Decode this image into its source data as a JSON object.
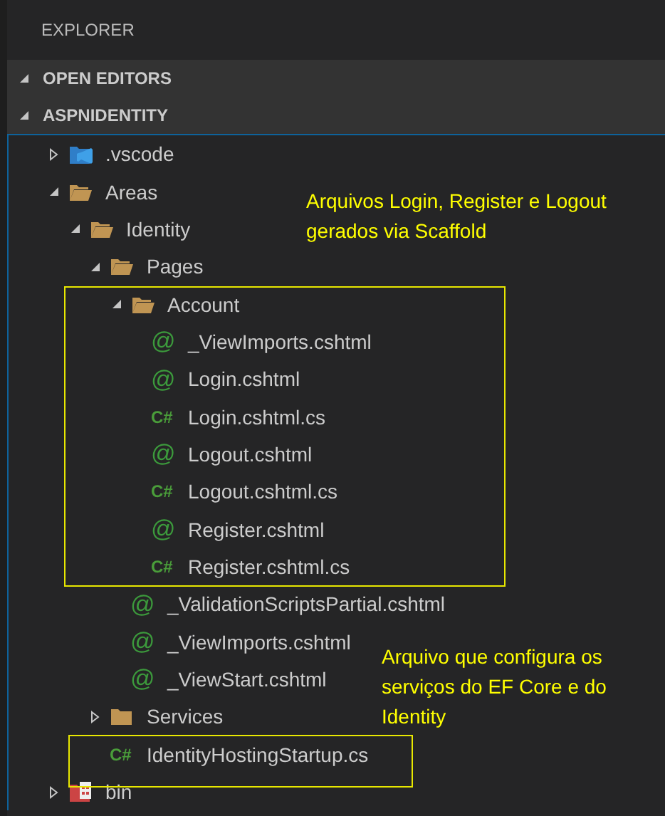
{
  "panel": {
    "title": "EXPLORER"
  },
  "sections": [
    {
      "label": "OPEN EDITORS",
      "expanded": true
    },
    {
      "label": "ASPNIDENTITY",
      "expanded": true
    }
  ],
  "tree": [
    {
      "label": ".vscode",
      "kind": "vscode-folder",
      "expanded": false
    },
    {
      "label": "Areas",
      "kind": "folder",
      "expanded": true,
      "children": [
        {
          "label": "Identity",
          "kind": "folder",
          "expanded": true,
          "children": [
            {
              "label": "Pages",
              "kind": "folder",
              "expanded": true,
              "children": [
                {
                  "label": "Account",
                  "kind": "folder",
                  "expanded": true,
                  "children": [
                    {
                      "label": "_ViewImports.cshtml",
                      "kind": "file",
                      "icon": "@"
                    },
                    {
                      "label": "Login.cshtml",
                      "kind": "file",
                      "icon": "@"
                    },
                    {
                      "label": "Login.cshtml.cs",
                      "kind": "file",
                      "icon": "C#"
                    },
                    {
                      "label": "Logout.cshtml",
                      "kind": "file",
                      "icon": "@"
                    },
                    {
                      "label": "Logout.cshtml.cs",
                      "kind": "file",
                      "icon": "C#"
                    },
                    {
                      "label": "Register.cshtml",
                      "kind": "file",
                      "icon": "@"
                    },
                    {
                      "label": "Register.cshtml.cs",
                      "kind": "file",
                      "icon": "C#"
                    }
                  ]
                },
                {
                  "label": "_ValidationScriptsPartial.cshtml",
                  "kind": "file",
                  "icon": "@"
                },
                {
                  "label": "_ViewImports.cshtml",
                  "kind": "file",
                  "icon": "@"
                },
                {
                  "label": "_ViewStart.cshtml",
                  "kind": "file",
                  "icon": "@"
                }
              ]
            },
            {
              "label": "Services",
              "kind": "folder",
              "expanded": false
            },
            {
              "label": "IdentityHostingStartup.cs",
              "kind": "file",
              "icon": "C#"
            }
          ]
        }
      ]
    },
    {
      "label": "bin",
      "kind": "bin-folder",
      "expanded": false
    }
  ],
  "annotations": [
    {
      "text": "Arquivos Login, Register e Logout gerados via Scaffold"
    },
    {
      "text": "Arquivo que configura os serviços do EF Core e do Identity"
    }
  ]
}
